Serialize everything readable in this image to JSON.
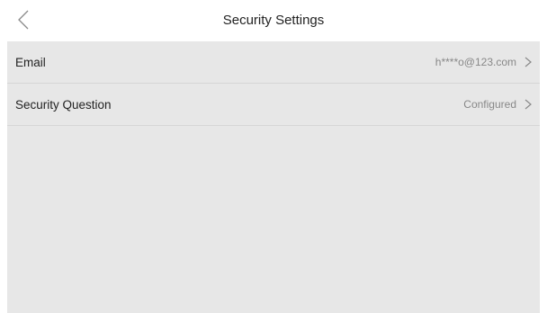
{
  "header": {
    "title": "Security Settings",
    "back_icon": "chevron-left-icon"
  },
  "settings": {
    "items": [
      {
        "label": "Email",
        "value": "h****o@123.com",
        "icon": "chevron-right-icon"
      },
      {
        "label": "Security Question",
        "value": "Configured",
        "icon": "chevron-right-icon"
      }
    ]
  },
  "colors": {
    "background": "#ffffff",
    "panel": "#e7e7e7",
    "divider": "#d6d6d6",
    "text_primary": "#222222",
    "text_secondary": "#888888"
  }
}
